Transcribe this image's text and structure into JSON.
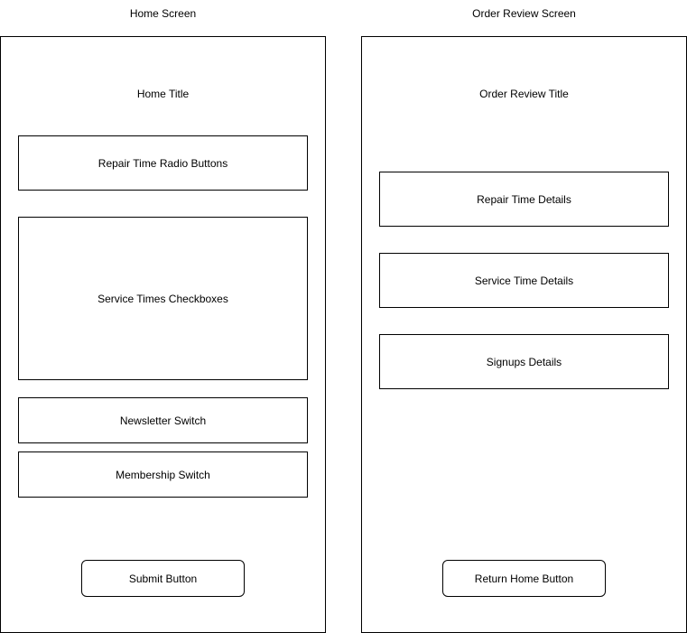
{
  "home_screen": {
    "caption": "Home Screen",
    "title": "Home Title",
    "sections": {
      "repair_time": "Repair Time Radio Buttons",
      "service_times": "Service Times Checkboxes",
      "newsletter": "Newsletter Switch",
      "membership": "Membership Switch"
    },
    "submit_button": "Submit Button"
  },
  "order_review_screen": {
    "caption": "Order Review Screen",
    "title": "Order Review Title",
    "sections": {
      "repair_time": "Repair Time Details",
      "service_time": "Service Time Details",
      "signups": "Signups Details"
    },
    "return_button": "Return Home Button"
  },
  "colors": {
    "stroke": "#000000",
    "background": "#ffffff"
  }
}
